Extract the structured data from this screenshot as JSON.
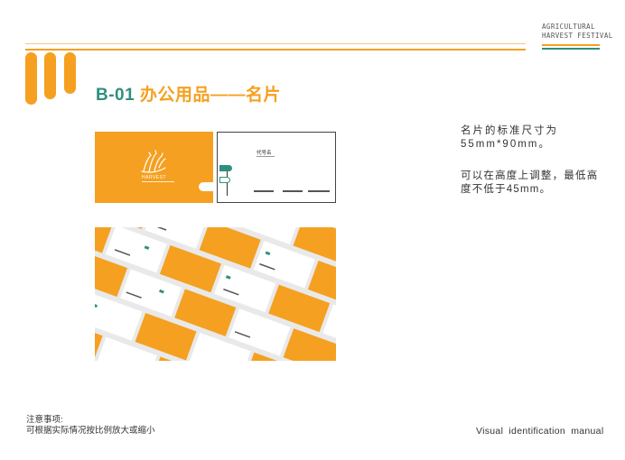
{
  "brand": {
    "line1": "AGRICULTURAL",
    "line2": "HARVEST FESTIVAL"
  },
  "header": {
    "code": "B-01",
    "title": "办公用品——名片"
  },
  "description": {
    "para1": "名片的标准尺寸为55mm*90mm。",
    "para2": "可以在高度上调整，最低高度不低于45mm。"
  },
  "business_card": {
    "front_logo_text": "HARVEST",
    "back_name": "代号名"
  },
  "notes": {
    "heading": "注意事项:",
    "body": "可根据实际情况按比例放大或缩小"
  },
  "footer": {
    "text": "Visual identification manual"
  },
  "colors": {
    "accent_orange": "#f5a020",
    "accent_green": "#2f8f7e"
  }
}
